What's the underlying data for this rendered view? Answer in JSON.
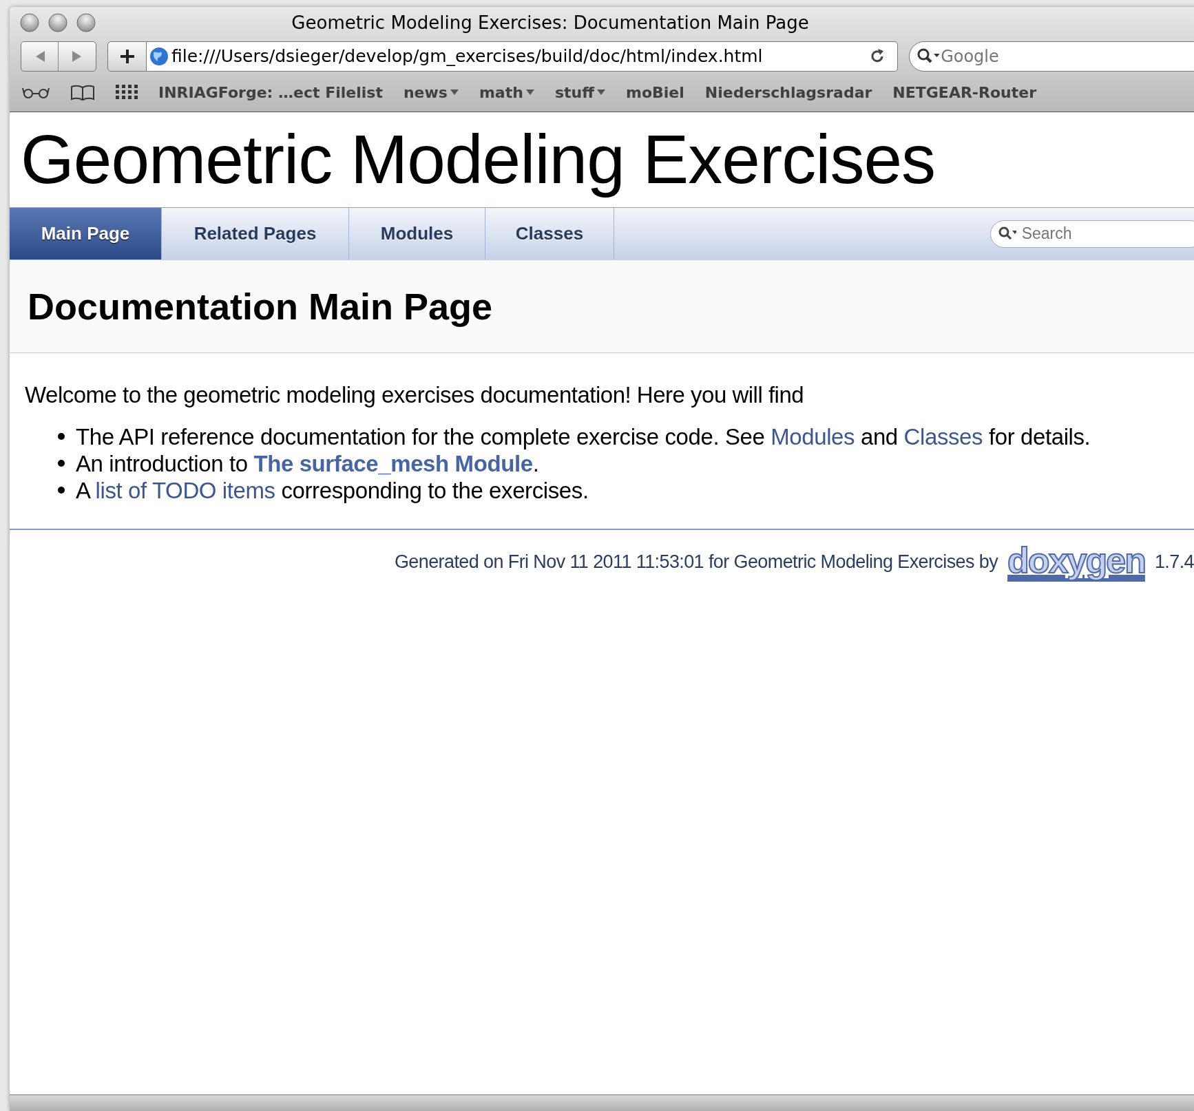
{
  "window": {
    "title": "Geometric Modeling Exercises: Documentation Main Page"
  },
  "address_bar": {
    "value": "file:///Users/dsieger/develop/gm_exercises/build/doc/html/index.html"
  },
  "search_field": {
    "placeholder": "Google"
  },
  "bookmarks": [
    {
      "label": "INRIAGForge: …ect Filelist",
      "menu": false
    },
    {
      "label": "news",
      "menu": true
    },
    {
      "label": "math",
      "menu": true
    },
    {
      "label": "stuff",
      "menu": true
    },
    {
      "label": "moBiel",
      "menu": false
    },
    {
      "label": "Niederschlagsradar",
      "menu": false
    },
    {
      "label": "NETGEAR-Router",
      "menu": false
    }
  ],
  "page": {
    "project_title": "Geometric Modeling Exercises",
    "tabs": [
      {
        "label": "Main Page",
        "selected": true
      },
      {
        "label": "Related Pages",
        "selected": false
      },
      {
        "label": "Modules",
        "selected": false
      },
      {
        "label": "Classes",
        "selected": false
      }
    ],
    "search": {
      "placeholder": "Search"
    },
    "heading": "Documentation Main Page",
    "intro": "Welcome to the geometric modeling exercises documentation! Here you will find",
    "items": [
      {
        "parts": [
          {
            "kind": "text",
            "text": "The API reference documentation for the complete exercise code. See "
          },
          {
            "kind": "link",
            "text": "Modules"
          },
          {
            "kind": "text",
            "text": " and "
          },
          {
            "kind": "link",
            "text": "Classes"
          },
          {
            "kind": "text",
            "text": " for details."
          }
        ]
      },
      {
        "parts": [
          {
            "kind": "text",
            "text": "An introduction to "
          },
          {
            "kind": "strong_link",
            "text": "The surface_mesh Module"
          },
          {
            "kind": "text",
            "text": "."
          }
        ]
      },
      {
        "parts": [
          {
            "kind": "text",
            "text": "A "
          },
          {
            "kind": "link",
            "text": "list of TODO items"
          },
          {
            "kind": "text",
            "text": " corresponding to the exercises."
          }
        ]
      }
    ],
    "footer": {
      "text": "Generated on Fri Nov 11 2011 11:53:01 for Geometric Modeling Exercises by",
      "logo": "doxygen",
      "version": "1.7.4"
    }
  }
}
